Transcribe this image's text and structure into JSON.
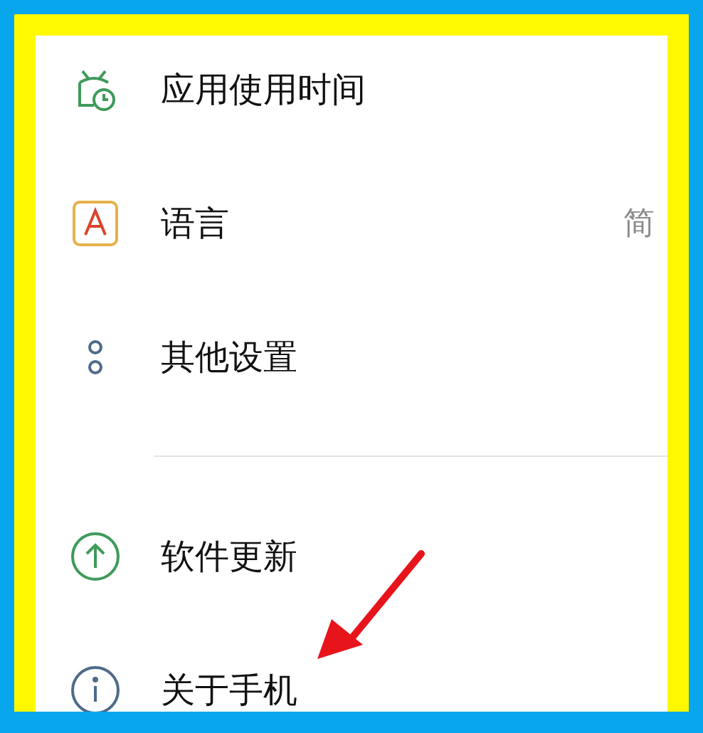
{
  "groups": [
    {
      "items": [
        {
          "kind": "timer",
          "label": "应用使用时间"
        },
        {
          "kind": "language",
          "label": "语言",
          "value": "简"
        },
        {
          "kind": "more",
          "label": "其他设置"
        }
      ]
    },
    {
      "items": [
        {
          "kind": "update",
          "label": "软件更新"
        },
        {
          "kind": "info",
          "label": "关于手机"
        }
      ]
    }
  ]
}
